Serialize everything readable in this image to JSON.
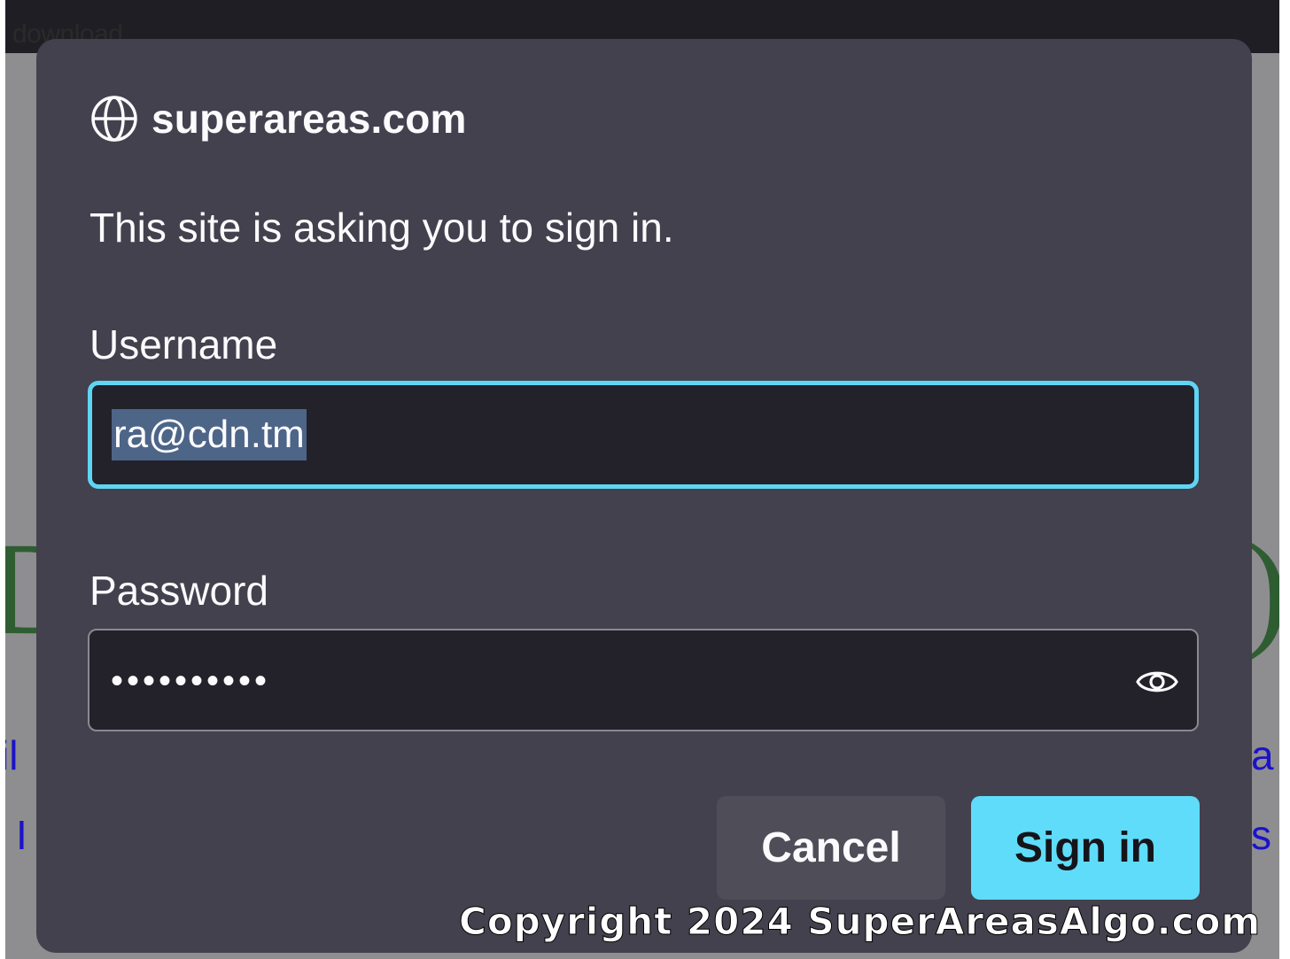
{
  "background_page": {
    "download_text": "download.",
    "left_link_top": "il",
    "left_link_bottom": "I",
    "right_link_top": "a",
    "right_link_bottom": "s"
  },
  "dialog": {
    "site": "superareas.com",
    "prompt": "This site is asking you to sign in.",
    "username_label": "Username",
    "username_value": "ra@cdn.tm",
    "password_label": "Password",
    "password_masked": "••••••••••",
    "cancel_label": "Cancel",
    "signin_label": "Sign in"
  },
  "watermark": "Copyright 2024 SuperAreasAlgo.com",
  "colors": {
    "dialog_bg": "#42414d",
    "input_bg": "#23222b",
    "focus_ring": "#5fd5f4",
    "primary_button": "#5fdcfa",
    "secondary_button": "#4e4d58"
  },
  "icons": {
    "site": "globe-icon",
    "password_toggle": "eye-icon"
  }
}
